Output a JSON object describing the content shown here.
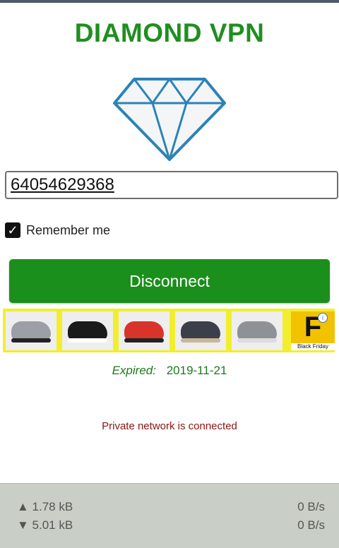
{
  "app": {
    "title": "DIAMOND VPN"
  },
  "login": {
    "phone_value": "64054629368",
    "remember_label": "Remember me",
    "remember_checked": true
  },
  "action": {
    "button_label": "Disconnect"
  },
  "ad": {
    "images": [
      "shoe-product-image",
      "slipper-product-image",
      "sandal-product-image",
      "sandal-product-image",
      "sneaker-product-image"
    ],
    "brand_letter": "F",
    "brand_caption": "Black Friday"
  },
  "subscription": {
    "expired_label": "Expired:",
    "expired_date": "2019-11-21"
  },
  "status": {
    "message": "Private network is connected"
  },
  "traffic": {
    "upload_total": "▲ 1.78 kB",
    "download_total": "▼ 5.01 kB",
    "upload_rate": "0 B/s",
    "download_rate": "0 B/s"
  },
  "colors": {
    "brand_green": "#1f8f1f",
    "button_green": "#1b8f1b",
    "status_red": "#8b1414",
    "ad_yellow": "#f2ee2e"
  }
}
